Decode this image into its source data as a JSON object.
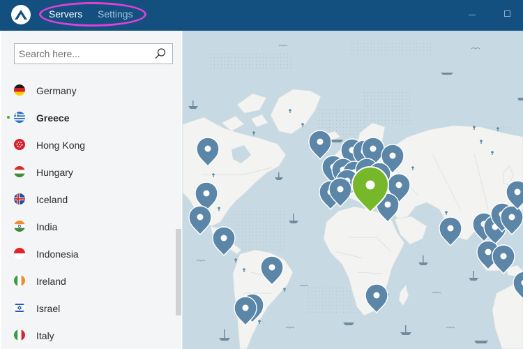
{
  "header": {
    "tabs": [
      {
        "label": "Servers",
        "active": true
      },
      {
        "label": "Settings",
        "active": false
      }
    ],
    "colors": {
      "bar": "#14507f",
      "accent": "#e040d8"
    }
  },
  "search": {
    "placeholder": "Search here...",
    "value": "",
    "icon": "search-icon"
  },
  "countries": [
    {
      "name": "Germany",
      "flag_icon": "germany-flag-icon"
    },
    {
      "name": "Greece",
      "flag_icon": "greece-flag-icon",
      "selected": true
    },
    {
      "name": "Hong Kong",
      "flag_icon": "hong-kong-flag-icon"
    },
    {
      "name": "Hungary",
      "flag_icon": "hungary-flag-icon"
    },
    {
      "name": "Iceland",
      "flag_icon": "iceland-flag-icon"
    },
    {
      "name": "India",
      "flag_icon": "india-flag-icon"
    },
    {
      "name": "Indonesia",
      "flag_icon": "indonesia-flag-icon"
    },
    {
      "name": "Ireland",
      "flag_icon": "ireland-flag-icon"
    },
    {
      "name": "Israel",
      "flag_icon": "israel-flag-icon"
    },
    {
      "name": "Italy",
      "flag_icon": "italy-flag-icon"
    }
  ],
  "map": {
    "connected_country": "Greece",
    "colors": {
      "sea": "#c7d9e2",
      "land": "#f3f4f2",
      "pin": "#5b86a8",
      "pin_active": "#76b82a"
    }
  }
}
